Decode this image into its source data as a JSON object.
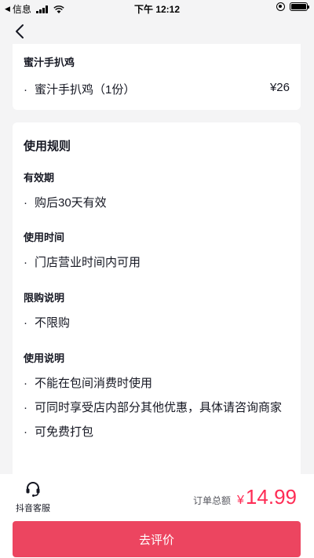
{
  "status_bar": {
    "carrier": "信息",
    "time": "下午 12:12",
    "battery_level": 1.0
  },
  "product": {
    "name": "蜜汁手扒鸡",
    "line_item": "蜜汁手扒鸡（1份）",
    "price": "¥26"
  },
  "rules": {
    "title": "使用规则",
    "validity": {
      "heading": "有效期",
      "items": [
        "购后30天有效"
      ]
    },
    "usage_time": {
      "heading": "使用时间",
      "items": [
        "门店营业时间内可用"
      ]
    },
    "purchase_limit": {
      "heading": "限购说明",
      "items": [
        "不限购"
      ]
    },
    "instructions": {
      "heading": "使用说明",
      "items": [
        "不能在包间消费时使用",
        "可同时享受店内部分其他优惠，具体请咨询商家",
        "可免费打包"
      ]
    }
  },
  "bottom": {
    "customer_service_label": "抖音客服",
    "total_label": "订单总额",
    "currency_symbol": "¥",
    "total_amount": "14.99",
    "review_button": "去评价"
  },
  "colors": {
    "accent": "#fe2c55",
    "button": "#ec4560",
    "background": "#f4f4f5"
  },
  "icons": {
    "back": "chevron-left-icon",
    "customer_service": "headset-icon"
  }
}
